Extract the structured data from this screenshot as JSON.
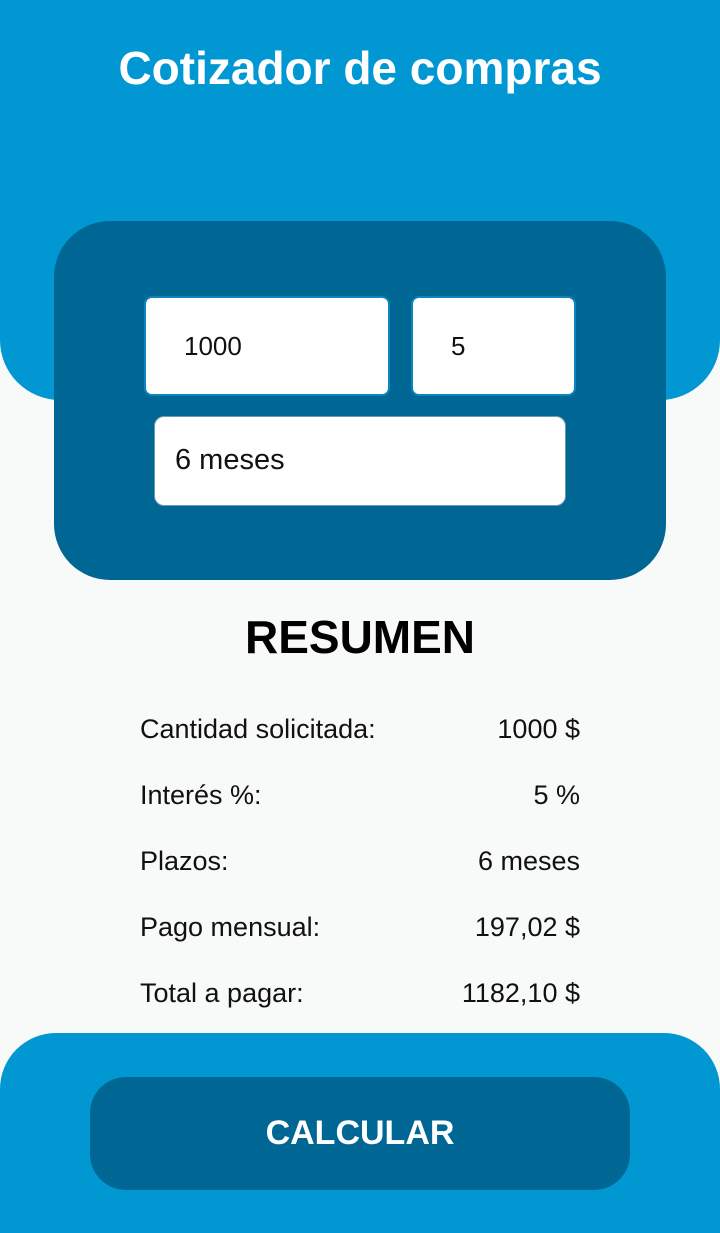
{
  "header": {
    "title": "Cotizador de compras"
  },
  "form": {
    "amount_value": "1000",
    "rate_value": "5",
    "term_value": "6 meses"
  },
  "summary": {
    "title": "RESUMEN",
    "rows": [
      {
        "label": "Cantidad solicitada:",
        "value": "1000 $"
      },
      {
        "label": "Interés %:",
        "value": "5 %"
      },
      {
        "label": "Plazos:",
        "value": "6 meses"
      },
      {
        "label": "Pago mensual:",
        "value": "197,02 $"
      },
      {
        "label": "Total a pagar:",
        "value": "1182,10 $"
      }
    ]
  },
  "footer": {
    "calculate_label": "CALCULAR"
  },
  "colors": {
    "primary": "#0197d3",
    "primary_dark": "#006794",
    "background": "#f8f9f9"
  }
}
